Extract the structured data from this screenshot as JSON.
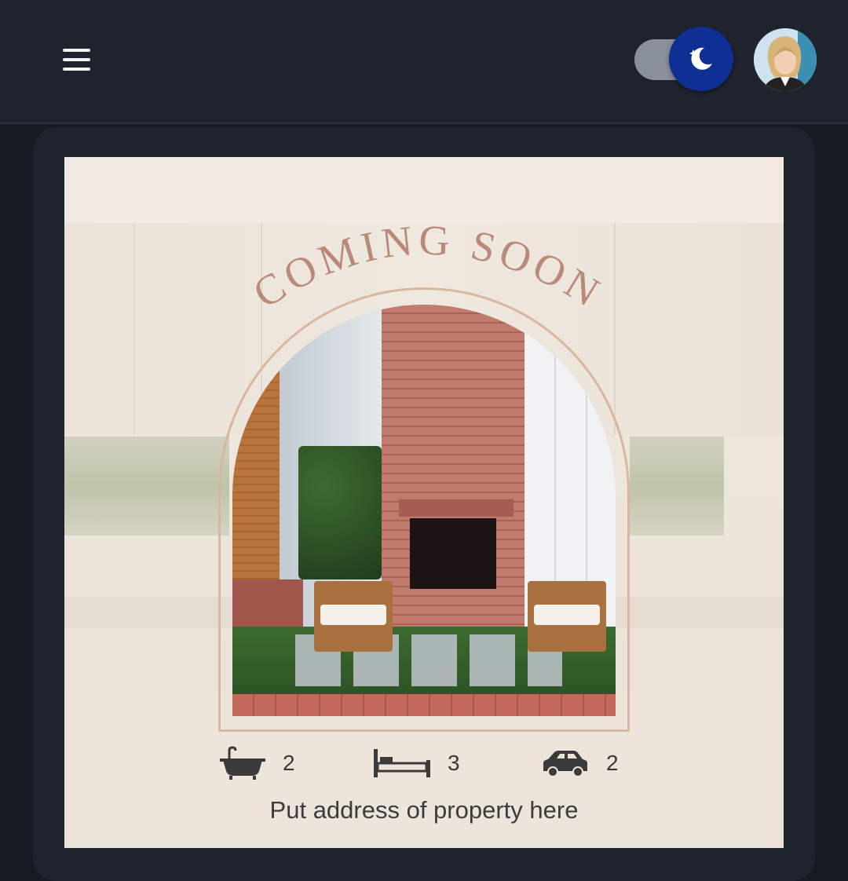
{
  "header": {
    "menu_icon": "hamburger-menu-icon",
    "theme_toggle": {
      "state": "dark",
      "icon": "moon-stars-icon",
      "accent": "#0f2f94"
    },
    "avatar_icon": "user-avatar"
  },
  "flyer": {
    "headline": "COMING SOON",
    "headline_color": "#b98a7a",
    "features": [
      {
        "icon": "bathtub-icon",
        "value": "2"
      },
      {
        "icon": "bed-icon",
        "value": "3"
      },
      {
        "icon": "car-icon",
        "value": "2"
      }
    ],
    "address": "Put address of property here"
  }
}
